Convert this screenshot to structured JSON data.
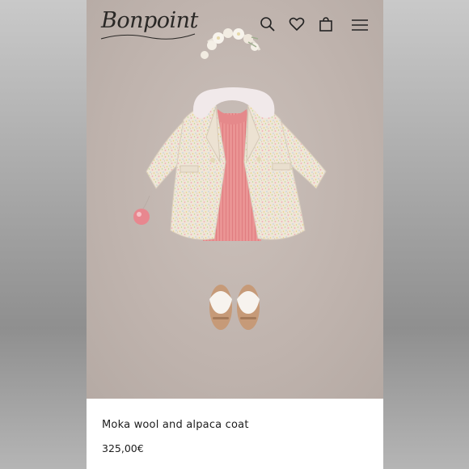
{
  "brand": {
    "logo_text": "Bonpoint"
  },
  "header": {
    "icons": [
      "search-icon",
      "heart-icon",
      "bag-icon",
      "menu-icon"
    ]
  },
  "product": {
    "name": "Moka wool and alpaca coat",
    "price": "325,00€"
  },
  "colors": {
    "background": "#c1b6b0",
    "coat": "#efe5d6",
    "dress": "#e88f8f",
    "collar": "#f1e9ea",
    "panel": "#ffffff",
    "text": "#1c1c1c"
  }
}
